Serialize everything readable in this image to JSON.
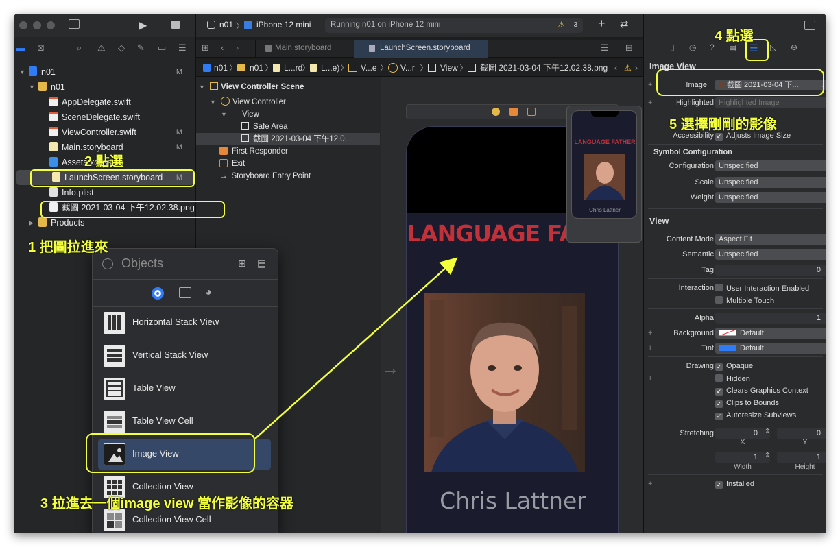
{
  "toolbar": {
    "scheme": "n01",
    "device": "iPhone 12 mini",
    "status": "Running n01 on iPhone 12 mini",
    "warnings": "3"
  },
  "tabs": [
    {
      "label": "Main.storyboard"
    },
    {
      "label": "LaunchScreen.storyboard"
    }
  ],
  "jumpbar": {
    "items": [
      "n01",
      "n01",
      "L...rd",
      "L...e)",
      "V...e",
      "V...r",
      "View",
      "截圖 2021-03-04 下午12.02.38.png"
    ]
  },
  "navigator": {
    "project": "n01",
    "project_badge": "M",
    "group": "n01",
    "files": [
      {
        "name": "AppDelegate.swift",
        "badge": ""
      },
      {
        "name": "SceneDelegate.swift",
        "badge": ""
      },
      {
        "name": "ViewController.swift",
        "badge": "M"
      },
      {
        "name": "Main.storyboard",
        "badge": "M"
      },
      {
        "name": "Assets.xcassets",
        "badge": ""
      },
      {
        "name": "LaunchScreen.storyboard",
        "badge": "M"
      },
      {
        "name": "Info.plist",
        "badge": ""
      }
    ],
    "dropped_image": "截圖 2021-03-04 下午12.02.38.png",
    "products": "Products"
  },
  "outline": {
    "scene": "View Controller Scene",
    "controller": "View Controller",
    "view": "View",
    "safe_area": "Safe Area",
    "image": "截圖 2021-03-04 下午12.0...",
    "first_responder": "First Responder",
    "exit": "Exit",
    "entry_point": "Storyboard Entry Point"
  },
  "canvas": {
    "title_text": "LANGUAGE FATHER",
    "name_text": "Chris Lattner",
    "thumb_title": "LANGUAGE FATHER",
    "thumb_name": "Chris Lattner"
  },
  "objects_panel": {
    "title": "Objects",
    "items": [
      {
        "label": "Horizontal Stack View"
      },
      {
        "label": "Vertical Stack View"
      },
      {
        "label": "Table View"
      },
      {
        "label": "Table View Cell"
      },
      {
        "label": "Image View"
      },
      {
        "label": "Collection View"
      },
      {
        "label": "Collection View Cell"
      }
    ]
  },
  "inspector": {
    "section_image_view": "Image View",
    "image_label": "Image",
    "image_value": "截圖 2021-03-04 下...",
    "highlighted_label": "Highlighted",
    "highlighted_placeholder": "Highlighted Image",
    "accessibility_label": "Accessibility",
    "adjusts_image_size": "Adjusts Image Size",
    "symbol_config": "Symbol Configuration",
    "configuration_label": "Configuration",
    "configuration_value": "Unspecified",
    "scale_label": "Scale",
    "scale_value": "Unspecified",
    "weight_label": "Weight",
    "weight_value": "Unspecified",
    "section_view": "View",
    "content_mode_label": "Content Mode",
    "content_mode_value": "Aspect Fit",
    "semantic_label": "Semantic",
    "semantic_value": "Unspecified",
    "tag_label": "Tag",
    "tag_value": "0",
    "interaction_label": "Interaction",
    "user_interaction": "User Interaction Enabled",
    "multiple_touch": "Multiple Touch",
    "alpha_label": "Alpha",
    "alpha_value": "1",
    "background_label": "Background",
    "background_value": "Default",
    "tint_label": "Tint",
    "tint_value": "Default",
    "drawing_label": "Drawing",
    "opaque": "Opaque",
    "hidden": "Hidden",
    "clears_graphics": "Clears Graphics Context",
    "clips_to_bounds": "Clips to Bounds",
    "autoresize": "Autoresize Subviews",
    "stretching_label": "Stretching",
    "stretch_x": "0",
    "stretch_y": "0",
    "x_label": "X",
    "y_label": "Y",
    "stretch_w": "1",
    "stretch_h": "1",
    "width_label": "Width",
    "height_label": "Height",
    "installed": "Installed"
  },
  "annotations": {
    "step1": "1 把圖拉進來",
    "step2": "2 點選",
    "step3": "3 拉進去一個image view 當作影像的容器",
    "step4": "4 點選",
    "step5": "5 選擇剛剛的影像"
  },
  "colors": {
    "highlight": "#f2ff3a",
    "accent_blue": "#2f7cf6",
    "poster_red": "#c0313a",
    "poster_bg": "#1a1c2e"
  }
}
